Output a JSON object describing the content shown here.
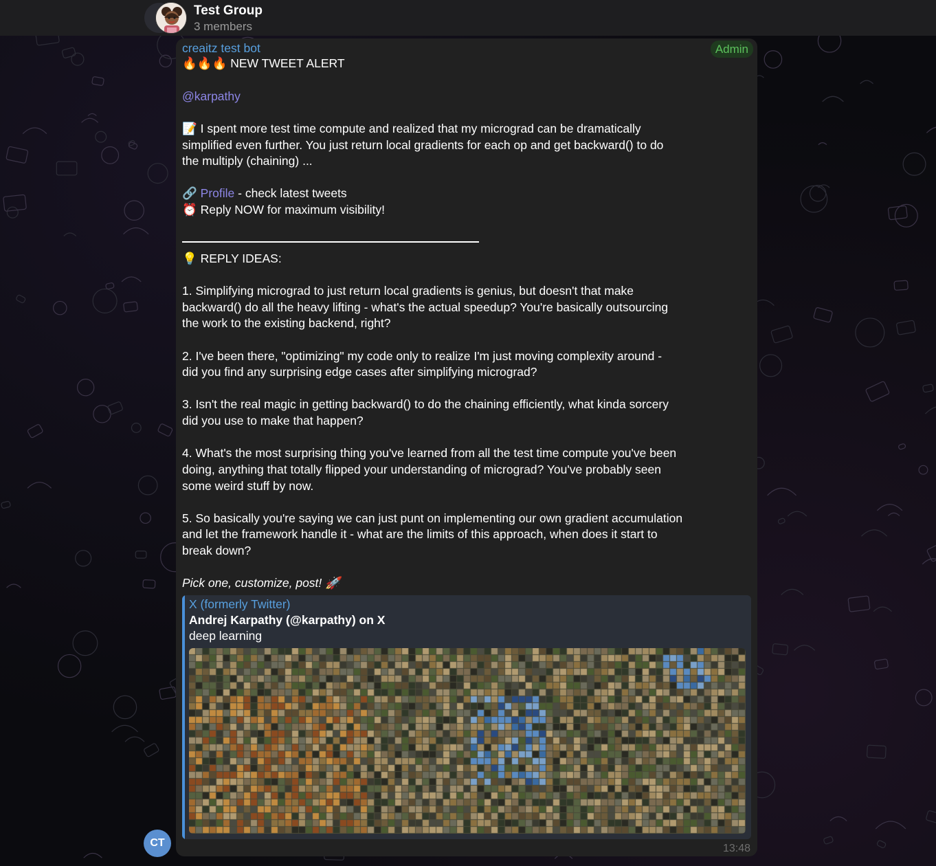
{
  "header": {
    "title": "Test Group",
    "subtitle": "3 members"
  },
  "message": {
    "sender": "creaitz test bot",
    "badge": "Admin",
    "alert_emoji": "🔥🔥🔥",
    "alert_text": "NEW TWEET ALERT",
    "mention": "@karpathy",
    "memo_emoji": "📝",
    "tweet_lines": [
      "I spent more test time compute and realized that my micrograd can be dramatically",
      "simplified even further. You just return local gradients for each op and get backward() to do",
      "the multiply (chaining) ..."
    ],
    "profile_emoji": "🔗",
    "profile_link": "Profile",
    "profile_rest": " - check latest tweets",
    "reply_emoji": "⏰",
    "reply_now": "Reply NOW for maximum visibility!",
    "ideas_emoji": "💡",
    "ideas_title": "REPLY IDEAS:",
    "ideas": [
      {
        "number": "1.",
        "lines": [
          "Simplifying micrograd to just return local gradients is genius, but doesn't that make",
          "backward() do all the heavy lifting - what's the actual speedup? You're basically outsourcing",
          "the work to the existing backend, right?"
        ]
      },
      {
        "number": "2.",
        "lines": [
          "I've been there, \"optimizing\" my code only to realize I'm just moving complexity around -",
          "did you find any surprising edge cases after simplifying micrograd?"
        ]
      },
      {
        "number": "3.",
        "lines": [
          "Isn't the real magic in getting backward() to do the chaining efficiently, what kinda sorcery",
          "did you use to make that happen?"
        ]
      },
      {
        "number": "4.",
        "lines": [
          "What's the most surprising thing you've learned from all the test time compute you've been",
          "doing, anything that totally flipped your understanding of micrograd? You've probably seen",
          "some weird stuff by now."
        ]
      },
      {
        "number": "5.",
        "lines": [
          "So basically you're saying we can just punt on implementing our own gradient accumulation",
          "and let the framework handle it - what are the limits of this approach, when does it start to",
          "break down?"
        ]
      }
    ],
    "closing": "Pick one, customize, post!",
    "closing_emoji": "🚀",
    "preview": {
      "site": "X (formerly Twitter)",
      "title": "Andrej Karpathy (@karpathy) on X",
      "description": "deep learning"
    },
    "time": "13:48"
  },
  "sender_avatar_initials": "CT",
  "colors": {
    "accent_blue": "#58a0df",
    "mention_purple": "#8d86e6",
    "admin_green": "#5cc15c",
    "bubble_bg": "#212121"
  }
}
